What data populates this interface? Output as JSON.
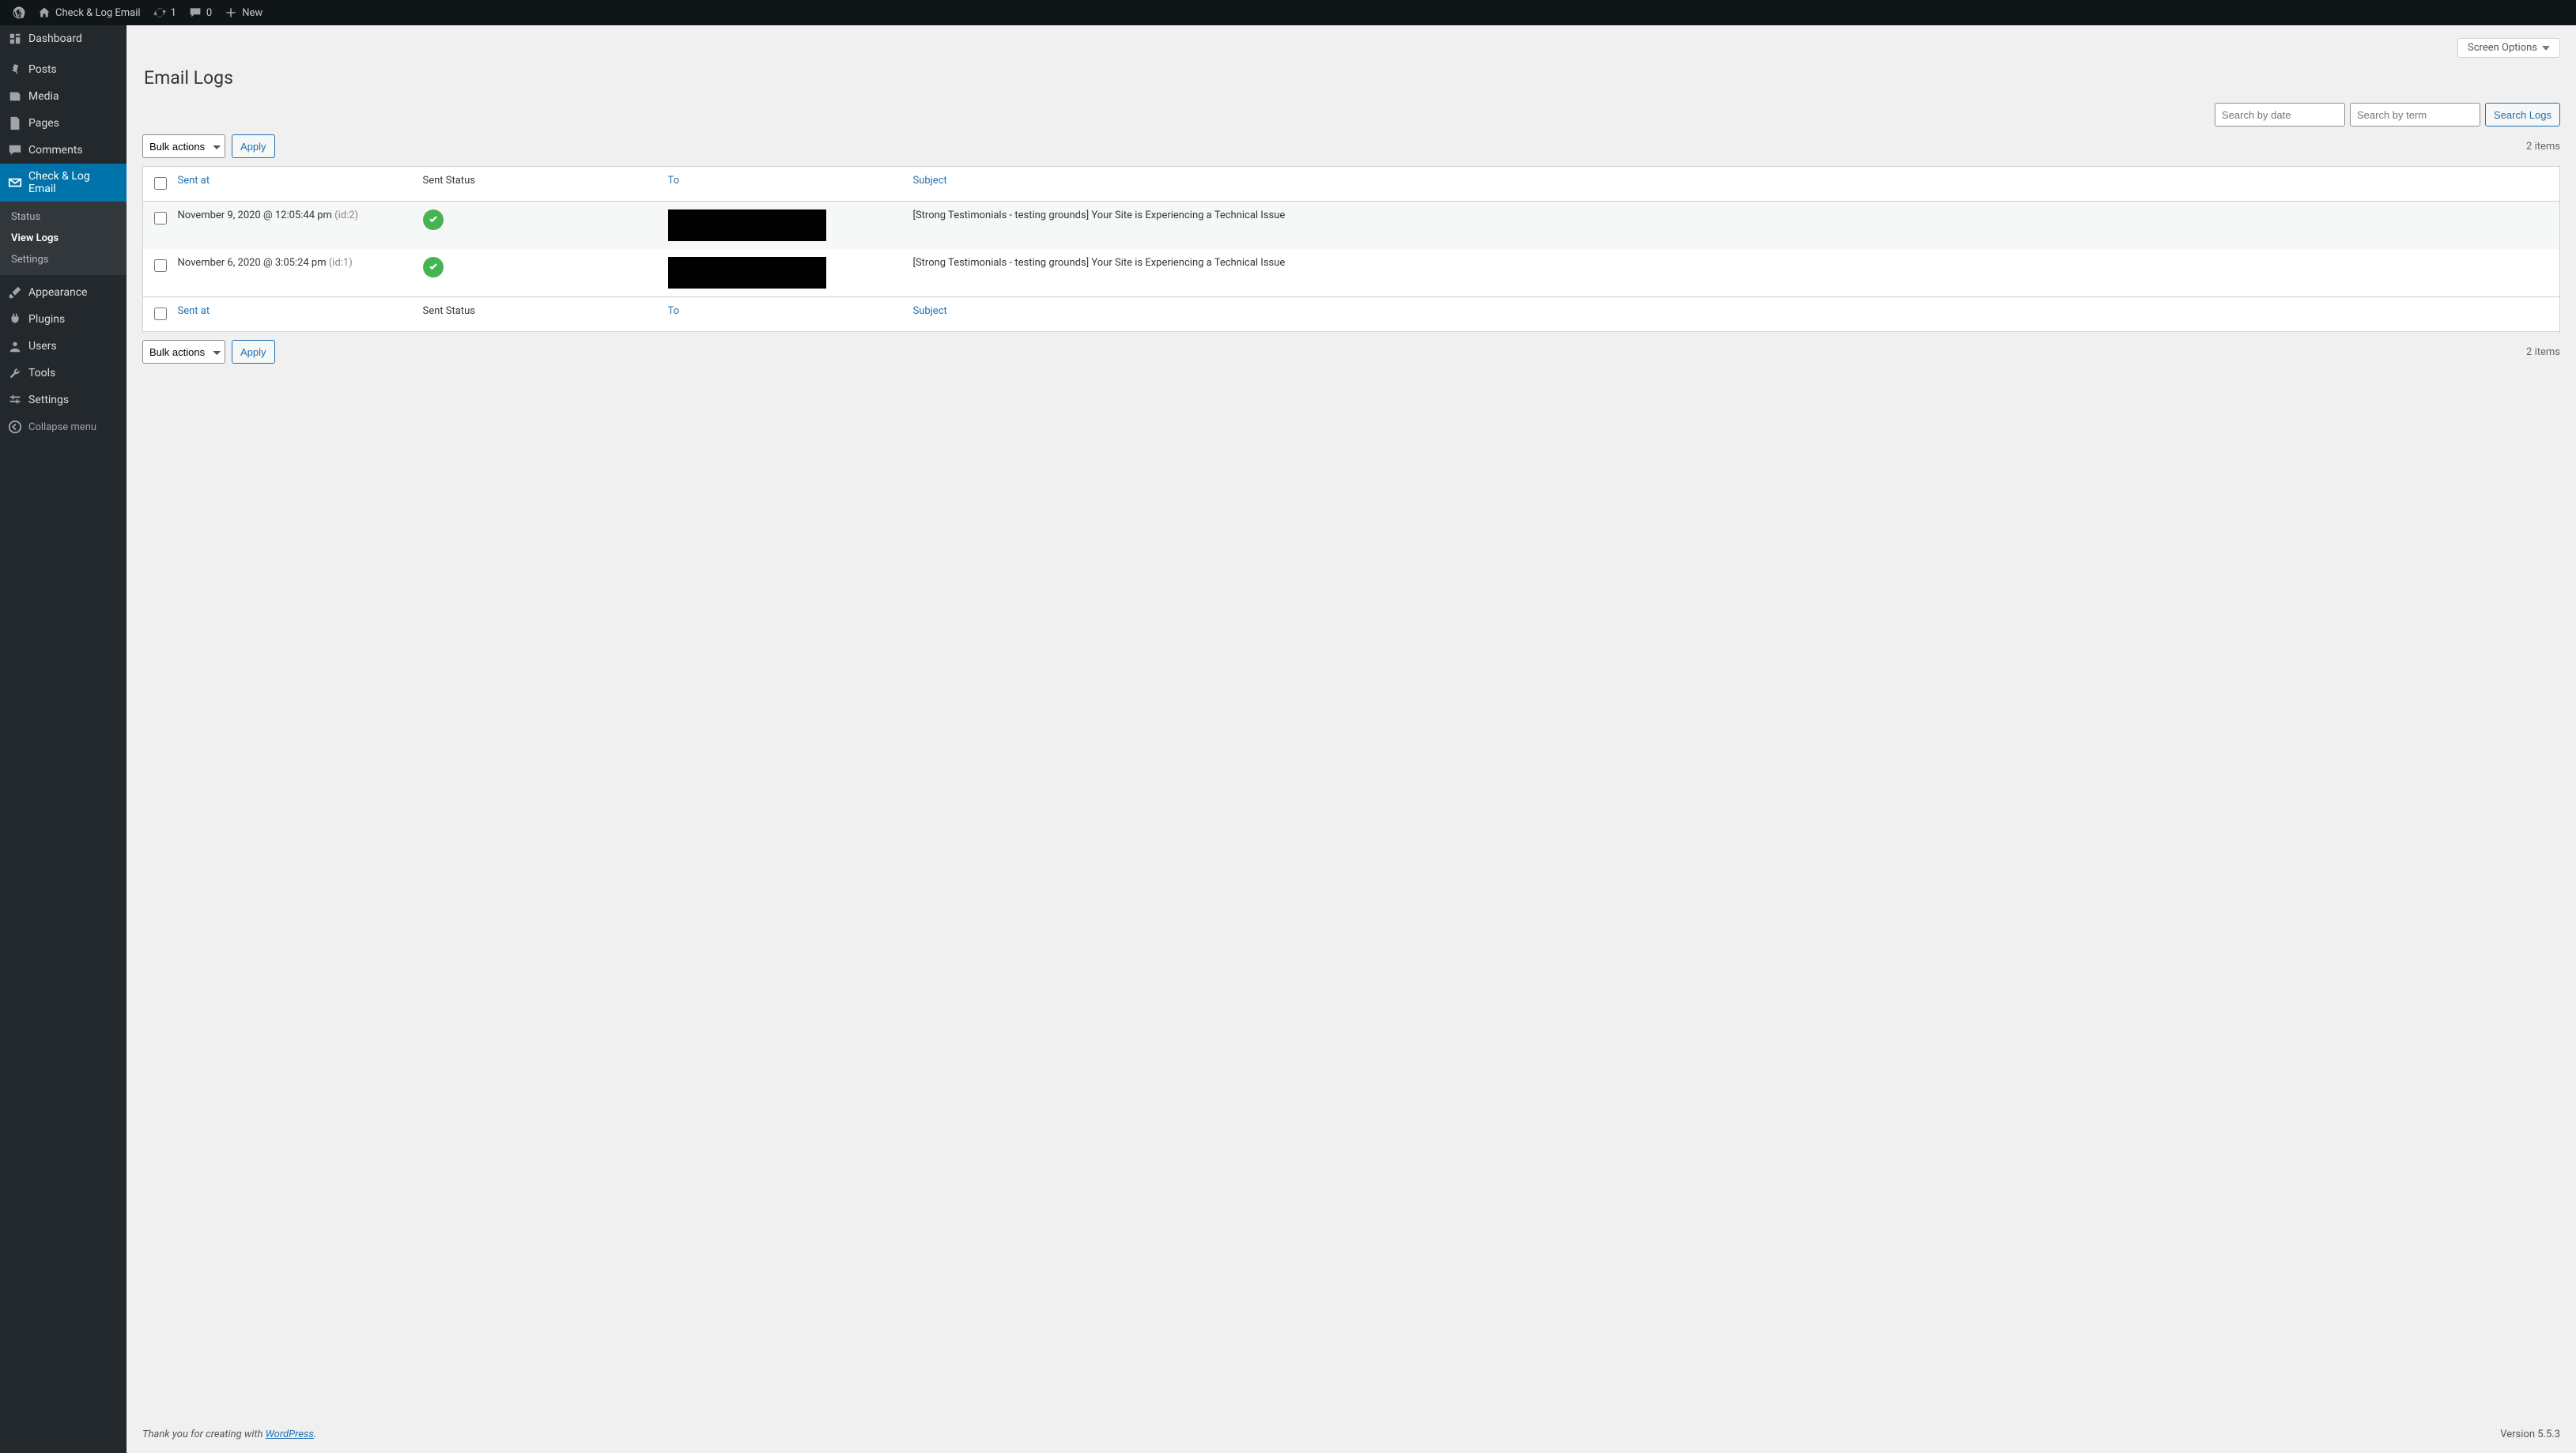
{
  "adminbar": {
    "site_name": "Check & Log Email",
    "updates_count": "1",
    "comments_count": "0",
    "new_label": "New"
  },
  "sidebar": {
    "items": [
      {
        "label": "Dashboard",
        "icon": "dashboard"
      },
      {
        "label": "Posts",
        "icon": "pin"
      },
      {
        "label": "Media",
        "icon": "media"
      },
      {
        "label": "Pages",
        "icon": "page"
      },
      {
        "label": "Comments",
        "icon": "comment"
      },
      {
        "label": "Check & Log Email",
        "icon": "mail",
        "active": true
      },
      {
        "label": "Appearance",
        "icon": "brush"
      },
      {
        "label": "Plugins",
        "icon": "plug"
      },
      {
        "label": "Users",
        "icon": "user"
      },
      {
        "label": "Tools",
        "icon": "wrench"
      },
      {
        "label": "Settings",
        "icon": "sliders"
      }
    ],
    "submenu": [
      {
        "label": "Status"
      },
      {
        "label": "View Logs",
        "current": true
      },
      {
        "label": "Settings"
      }
    ],
    "collapse_label": "Collapse menu"
  },
  "page": {
    "screen_options_label": "Screen Options",
    "heading": "Email Logs",
    "search_date_placeholder": "Search by date",
    "search_term_placeholder": "Search by term",
    "search_button": "Search Logs",
    "bulk_actions_label": "Bulk actions",
    "apply_label": "Apply",
    "items_count": "2 items"
  },
  "table": {
    "columns": {
      "sent_at": "Sent at",
      "status": "Sent Status",
      "to": "To",
      "subject": "Subject"
    },
    "rows": [
      {
        "sent_at": "November 9, 2020 @ 12:05:44 pm",
        "id_tag": "(id:2)",
        "status_ok": true,
        "to_redacted": true,
        "subject": "[Strong Testimonials - testing grounds] Your Site is Experiencing a Technical Issue"
      },
      {
        "sent_at": "November 6, 2020 @ 3:05:24 pm",
        "id_tag": "(id:1)",
        "status_ok": true,
        "to_redacted": true,
        "subject": "[Strong Testimonials - testing grounds] Your Site is Experiencing a Technical Issue"
      }
    ]
  },
  "footer": {
    "prefix": "Thank you for creating with ",
    "link_text": "WordPress",
    "suffix": ".",
    "version": "Version 5.5.3"
  }
}
